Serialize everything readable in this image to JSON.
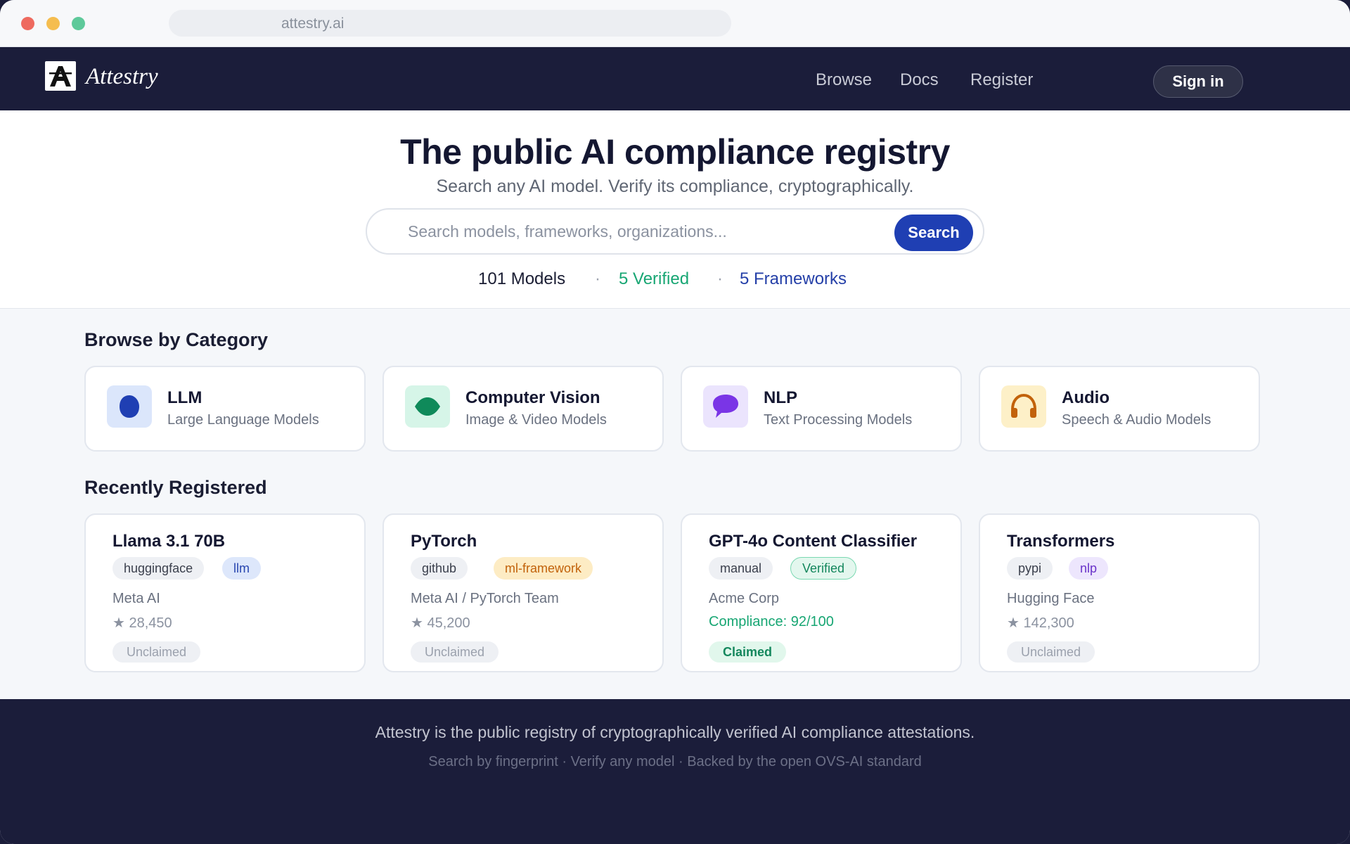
{
  "browser": {
    "url": "attestry.ai"
  },
  "nav": {
    "brand": "Attestry",
    "links": [
      "Browse",
      "Docs",
      "Register"
    ],
    "sign_in": "Sign in"
  },
  "hero": {
    "title": "The public AI compliance registry",
    "subtitle": "Search any AI model. Verify its compliance, cryptographically.",
    "search_placeholder": "Search models, frameworks, organizations...",
    "search_button": "Search",
    "stats": {
      "models": "101 Models",
      "separator": "·",
      "verified": "5 Verified",
      "frameworks": "5 Frameworks"
    }
  },
  "categories": {
    "title": "Browse by Category",
    "items": [
      {
        "name": "LLM",
        "desc": "Large Language Models",
        "icon": "llm-icon",
        "icon_bg": "#dbe6fb",
        "icon_color": "#1f3fb3"
      },
      {
        "name": "Computer Vision",
        "desc": "Image & Video Models",
        "icon": "eye-icon",
        "icon_bg": "#d6f5e8",
        "icon_color": "#0f8a5a"
      },
      {
        "name": "NLP",
        "desc": "Text Processing Models",
        "icon": "speech-bubble-icon",
        "icon_bg": "#ebe4fd",
        "icon_color": "#7a35e6"
      },
      {
        "name": "Audio",
        "desc": "Speech & Audio Models",
        "icon": "headphones-icon",
        "icon_bg": "#fdf0c8",
        "icon_color": "#c2620b"
      }
    ]
  },
  "recent": {
    "title": "Recently Registered",
    "items": [
      {
        "name": "Llama 3.1 70B",
        "tags": [
          "huggingface",
          "llm"
        ],
        "org": "Meta AI",
        "stars": "★ 28,450",
        "status": "Unclaimed"
      },
      {
        "name": "PyTorch",
        "tags": [
          "github",
          "ml-framework"
        ],
        "org": "Meta AI / PyTorch Team",
        "stars": "★ 45,200",
        "status": "Unclaimed"
      },
      {
        "name": "GPT-4o Content Classifier",
        "tags": [
          "manual",
          "Verified"
        ],
        "org": "Acme Corp",
        "compliance": "Compliance: 92/100",
        "status": "Claimed"
      },
      {
        "name": "Transformers",
        "tags": [
          "pypi",
          "nlp"
        ],
        "org": "Hugging Face",
        "stars": "★ 142,300",
        "status": "Unclaimed"
      }
    ]
  },
  "footer": {
    "line1": "Attestry is the public registry of cryptographically verified AI compliance attestations.",
    "line2": "Search by fingerprint · Verify any model · Backed by the open OVS-AI standard"
  },
  "colors": {
    "navy": "#1b1d3a",
    "accent_blue": "#1f3fb3",
    "verified_green": "#17a673"
  }
}
